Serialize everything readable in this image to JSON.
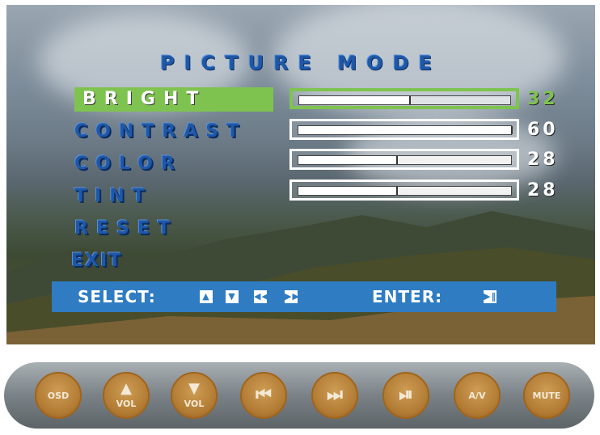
{
  "osd": {
    "title": "PICTURE MODE",
    "items": [
      {
        "label": "BRIGHT",
        "value": "32",
        "level": 0.52,
        "active": true
      },
      {
        "label": "CONTRAST",
        "value": "60",
        "level": 1.0,
        "active": false
      },
      {
        "label": "COLOR",
        "value": "28",
        "level": 0.46,
        "active": false
      },
      {
        "label": "TINT",
        "value": "28",
        "level": 0.46,
        "active": false
      },
      {
        "label": "RESET"
      },
      {
        "label": "EXIT"
      }
    ],
    "select_label": "SELECT:",
    "enter_label": "ENTER:",
    "colors": {
      "accent": "#7ec34f",
      "menu_text": "#1f58a8",
      "select_bar": "#2f7cc2"
    }
  },
  "buttons": [
    {
      "name": "osd",
      "label": "OSD",
      "icon": "text"
    },
    {
      "name": "vol-up",
      "label": "VOL",
      "icon": "triangle-up-icon"
    },
    {
      "name": "vol-down",
      "label": "VOL",
      "icon": "triangle-down-icon"
    },
    {
      "name": "previous",
      "label": "",
      "icon": "skip-back-icon"
    },
    {
      "name": "next",
      "label": "",
      "icon": "skip-forward-icon"
    },
    {
      "name": "play-pause",
      "label": "",
      "icon": "play-pause-icon"
    },
    {
      "name": "av",
      "label": "A/V",
      "icon": "text"
    },
    {
      "name": "mute",
      "label": "MUTE",
      "icon": "text"
    }
  ]
}
